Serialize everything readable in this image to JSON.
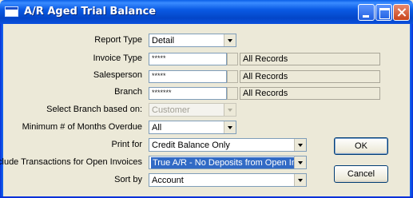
{
  "window": {
    "title": "A/R Aged Trial Balance"
  },
  "form": {
    "report_type": {
      "label": "Report Type",
      "value": "Detail"
    },
    "invoice_type": {
      "label": "Invoice Type",
      "value": "*****",
      "info": "All Records"
    },
    "salesperson": {
      "label": "Salesperson",
      "value": "*****",
      "info": "All Records"
    },
    "branch": {
      "label": "Branch",
      "value": "*******",
      "info": "All Records"
    },
    "select_branch": {
      "label": "Select Branch based on:",
      "value": "Customer"
    },
    "min_months": {
      "label": "Minimum # of Months Overdue",
      "value": "All"
    },
    "print_for": {
      "label": "Print for",
      "value": "Credit Balance Only"
    },
    "include_transactions": {
      "label": "Include Transactions for Open Invoices",
      "value": "True A/R - No Deposits from Open Invoic"
    },
    "sort_by": {
      "label": "Sort by",
      "value": "Account"
    }
  },
  "buttons": {
    "ok": "OK",
    "cancel": "Cancel"
  }
}
